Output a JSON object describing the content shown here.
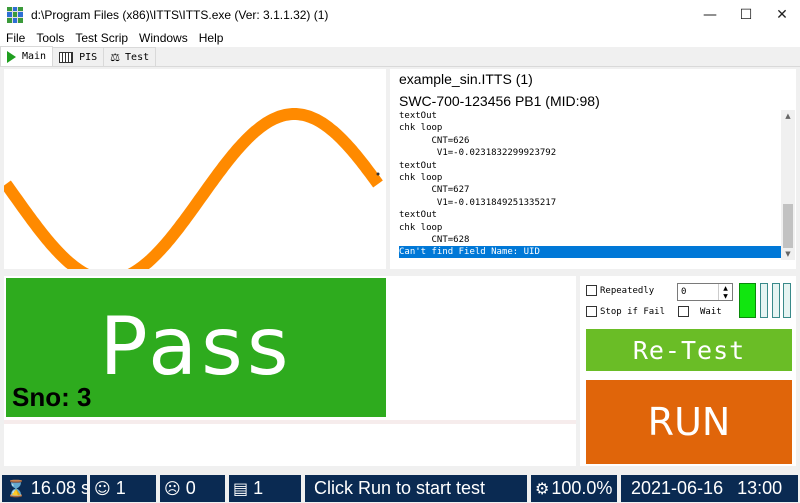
{
  "window": {
    "title": "d:\\Program Files (x86)\\ITTS\\ITTS.exe    (Ver: 3.1.1.32) (1)"
  },
  "menu": [
    "File",
    "Tools",
    "Test Scrip",
    "Windows",
    "Help"
  ],
  "tabs": [
    {
      "label": "Main",
      "icon": "play-icon"
    },
    {
      "label": "PIS",
      "icon": "film-icon"
    },
    {
      "label": "Test",
      "icon": "flask-icon"
    }
  ],
  "wave": {
    "color": "#ff8a00",
    "cycles": 1.0
  },
  "log": {
    "file": "example_sin.ITTS  (1)",
    "device": "SWC-700-123456 PB1 (MID:98)",
    "lines": [
      "textOut",
      "chk loop",
      "      CNT=626",
      "       V1=-0.0231832299923792",
      "textOut",
      "chk loop",
      "      CNT=627",
      "       V1=-0.0131849251335217",
      "textOut",
      "chk loop",
      "      CNT=628",
      "Can't find Field Name: UID"
    ],
    "selected_index": 11
  },
  "result": {
    "status": "Pass",
    "sno": "Sno: 3",
    "color": "#2eab1e"
  },
  "controls": {
    "repeatedly_label": "Repeatedly",
    "stop_if_fail_label": "Stop if Fail",
    "wait_label": "Wait",
    "repeat_count": "0",
    "retest_label": "Re-Test",
    "run_label": "RUN"
  },
  "status": {
    "time": "16.08 s",
    "pass_count": "1",
    "fail_count": "0",
    "doc_count": "1",
    "message": "Click Run to start test",
    "progress": "100.0%",
    "date": "2021-06-16",
    "clock": "13:00"
  }
}
